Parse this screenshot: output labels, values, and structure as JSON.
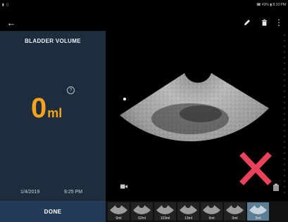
{
  "status_bar": {
    "left": "▮ ▯",
    "right": "☎ 43% ▮ 8:10 PM"
  },
  "app_bar": {
    "back_icon": "back-arrow-icon",
    "edit_icon": "pencil-icon",
    "delete_icon": "trash-icon",
    "menu_icon": "more-vert-icon"
  },
  "panel": {
    "title": "BLADDER VOLUME",
    "help": "?",
    "volume_value": "0",
    "volume_unit": "ml",
    "date": "1/4/2019",
    "time": "9:25 PM"
  },
  "done_label": "DONE",
  "colors": {
    "accent": "#f7a21b",
    "panel_bg": "#1d2d3e",
    "done_bg": "#243b57",
    "delete_mark": "#e8435b"
  },
  "thumbnails": [
    {
      "label": "0ml",
      "selected": false
    },
    {
      "label": "52ml",
      "selected": false
    },
    {
      "label": "103ml",
      "selected": false
    },
    {
      "label": "13ml",
      "selected": false
    },
    {
      "label": "0ml",
      "selected": false
    },
    {
      "label": "0ml",
      "selected": false
    },
    {
      "label": "0ml",
      "selected": true
    }
  ]
}
